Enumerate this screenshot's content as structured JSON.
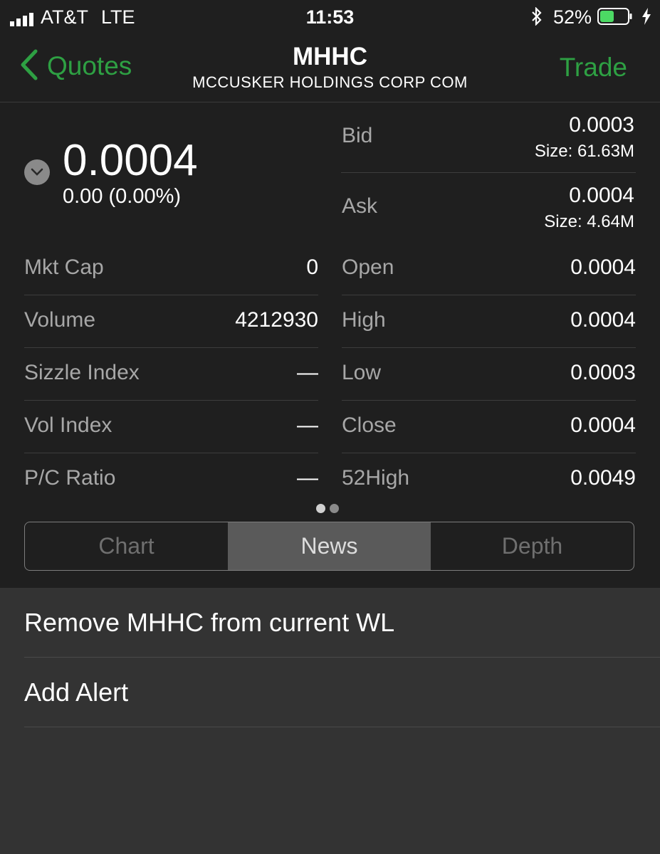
{
  "status_bar": {
    "carrier": "AT&T",
    "network": "LTE",
    "time": "11:53",
    "battery_pct": "52%",
    "battery_level": 0.52
  },
  "nav": {
    "back_label": "Quotes",
    "title": "MHHC",
    "subtitle": "MCCUSKER HOLDINGS CORP COM",
    "trade_label": "Trade"
  },
  "quote": {
    "price": "0.0004",
    "change": "0.00 (0.00%)"
  },
  "bid": {
    "label": "Bid",
    "value": "0.0003",
    "size": "Size: 61.63M"
  },
  "ask": {
    "label": "Ask",
    "value": "0.0004",
    "size": "Size: 4.64M"
  },
  "left_stats": [
    {
      "label": "Mkt Cap",
      "value": "0"
    },
    {
      "label": "Volume",
      "value": "4212930"
    },
    {
      "label": "Sizzle Index",
      "value": "—"
    },
    {
      "label": "Vol Index",
      "value": "—"
    },
    {
      "label": "P/C Ratio",
      "value": "—"
    }
  ],
  "right_stats": [
    {
      "label": "Open",
      "value": "0.0004"
    },
    {
      "label": "High",
      "value": "0.0004"
    },
    {
      "label": "Low",
      "value": "0.0003"
    },
    {
      "label": "Close",
      "value": "0.0004"
    },
    {
      "label": "52High",
      "value": "0.0049"
    }
  ],
  "tabs": [
    {
      "label": "Chart"
    },
    {
      "label": "News",
      "selected": true
    },
    {
      "label": "Depth"
    }
  ],
  "menu": [
    {
      "label": "Remove MHHC from current WL"
    },
    {
      "label": "Add Alert"
    }
  ],
  "colors": {
    "accent": "#2ea043",
    "background": "#1f1f1f",
    "sheet": "#333333",
    "battery": "#4cd964"
  },
  "icons": {
    "back": "chevron-left-icon",
    "expand": "chevron-down-icon",
    "bluetooth": "bluetooth-icon",
    "battery": "battery-icon",
    "charging": "bolt-icon",
    "signal": "signal-bars-icon"
  }
}
